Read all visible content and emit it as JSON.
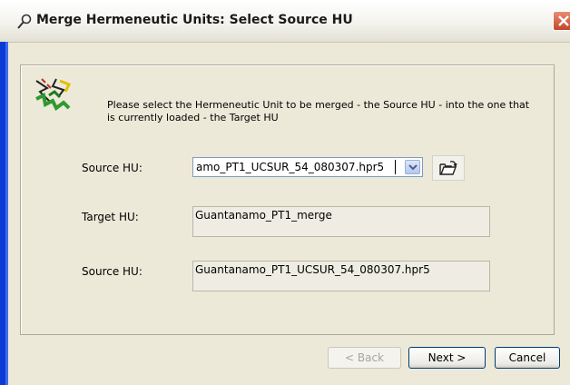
{
  "window": {
    "title": "Merge Hermeneutic Units: Select Source HU"
  },
  "intro_text": "Please select the Hermeneutic Unit to be merged - the Source HU - into the one that is currently loaded - the Target HU",
  "source_select": {
    "label": "Source HU:",
    "value": "amo_PT1_UCSUR_54_080307.hpr5"
  },
  "target_field": {
    "label": "Target HU:",
    "value": "Guantanamo_PT1_merge"
  },
  "source_field": {
    "label": "Source HU:",
    "value": "Guantanamo_PT1_UCSUR_54_080307.hpr5"
  },
  "buttons": {
    "back": "< Back",
    "next": "Next >",
    "cancel": "Cancel"
  },
  "icons": [
    "magnifier-icon",
    "close-icon",
    "merge-logo-icon",
    "dropdown-arrow-icon",
    "open-folder-icon"
  ]
}
